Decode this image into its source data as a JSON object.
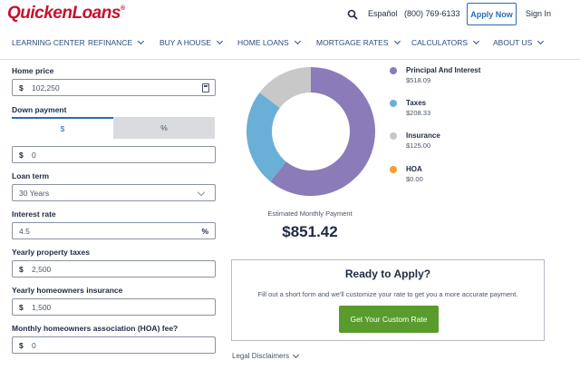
{
  "header": {
    "logo_text": "QuickenLoans",
    "logo_mark": "®",
    "language": "Español",
    "phone": "(800) 769-6133",
    "apply_label": "Apply Now",
    "signin_label": "Sign In"
  },
  "nav": [
    {
      "label": "LEARNING CENTER",
      "dropdown": false
    },
    {
      "label": "REFINANCE",
      "dropdown": true
    },
    {
      "label": "BUY A HOUSE",
      "dropdown": true
    },
    {
      "label": "HOME LOANS",
      "dropdown": true
    },
    {
      "label": "MORTGAGE RATES",
      "dropdown": true
    },
    {
      "label": "CALCULATORS",
      "dropdown": true
    },
    {
      "label": "ABOUT US",
      "dropdown": true
    }
  ],
  "form": {
    "home_price_label": "Home price",
    "home_price_prefix": "$",
    "home_price_value": "102,250",
    "down_payment_label": "Down payment",
    "down_toggle_dollar": "$",
    "down_toggle_percent": "%",
    "down_prefix": "$",
    "down_value": "0",
    "loan_term_label": "Loan term",
    "loan_term_value": "30 Years",
    "interest_label": "Interest rate",
    "interest_value": "4.5",
    "interest_suffix": "%",
    "tax_label": "Yearly property taxes",
    "tax_prefix": "$",
    "tax_value": "2,500",
    "insurance_label": "Yearly homeowners insurance",
    "insurance_prefix": "$",
    "insurance_value": "1,500",
    "hoa_label": "Monthly homeowners association (HOA) fee?",
    "hoa_prefix": "$",
    "hoa_value": "0"
  },
  "result": {
    "estimate_label": "Estimated Monthly Payment",
    "estimate_value": "$851.42"
  },
  "chart_data": {
    "type": "pie",
    "categories": [
      "Principal And Interest",
      "Taxes",
      "Insurance",
      "HOA"
    ],
    "labels": [
      "$518.09",
      "$208.33",
      "$125.00",
      "$0.00"
    ],
    "values": [
      518.09,
      208.33,
      125.0,
      0.0
    ],
    "colors": [
      "#8b7bb8",
      "#6aafd6",
      "#c8c8c8",
      "#f0a030"
    ],
    "donut": true
  },
  "ready": {
    "title": "Ready to Apply?",
    "text": "Fill out a short form and we'll customize your rate to get you a more accurate payment.",
    "button_label": "Get Your Custom Rate"
  },
  "disclaimer_label": "Legal Disclaimers"
}
